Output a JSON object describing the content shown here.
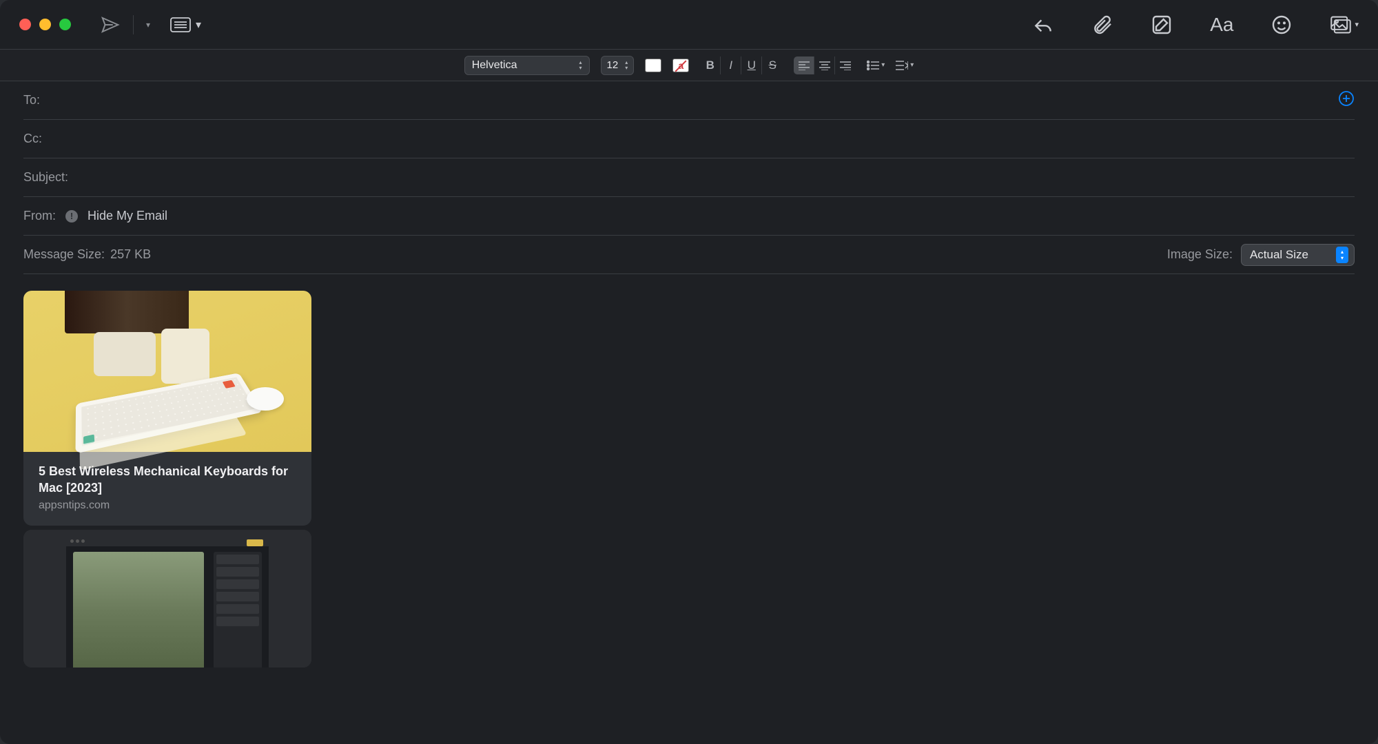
{
  "toolbar": {
    "font_name": "Helvetica",
    "font_size": "12"
  },
  "fields": {
    "to_label": "To:",
    "cc_label": "Cc:",
    "subject_label": "Subject:",
    "from_label": "From:",
    "hide_email": "Hide My Email",
    "msg_size_label": "Message Size:",
    "msg_size_value": "257 KB",
    "img_size_label": "Image Size:",
    "img_size_value": "Actual Size"
  },
  "card": {
    "title": "5 Best Wireless Mechanical Keyboards for Mac [2023]",
    "domain": "appsntips.com"
  }
}
